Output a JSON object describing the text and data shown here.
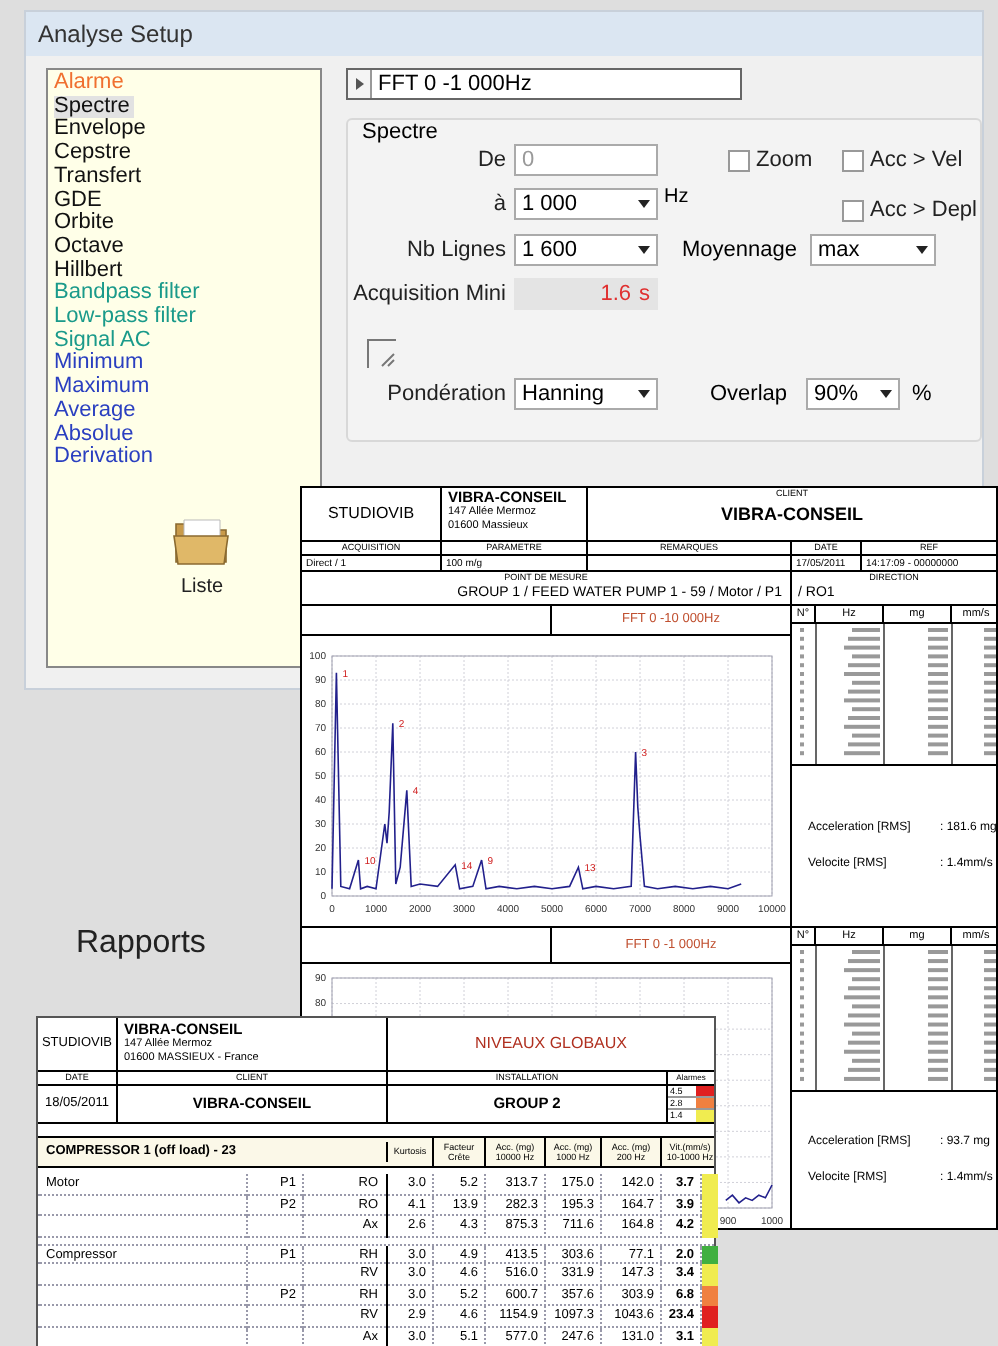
{
  "setup_window": {
    "title": "Analyse Setup",
    "analysis_list": [
      {
        "label": "Alarme",
        "kind": "alarm",
        "selected": false
      },
      {
        "label": "Spectre",
        "kind": "spectral",
        "selected": true
      },
      {
        "label": "Envelope",
        "kind": "spectral",
        "selected": false
      },
      {
        "label": "Cepstre",
        "kind": "spectral",
        "selected": false
      },
      {
        "label": "Transfert",
        "kind": "spectral",
        "selected": false
      },
      {
        "label": "GDE",
        "kind": "spectral",
        "selected": false
      },
      {
        "label": "Orbite",
        "kind": "spectral",
        "selected": false
      },
      {
        "label": "Octave",
        "kind": "spectral",
        "selected": false
      },
      {
        "label": "Hillbert",
        "kind": "spectral",
        "selected": false
      },
      {
        "label": "Bandpass filter",
        "kind": "filter",
        "selected": false
      },
      {
        "label": "Low-pass filter",
        "kind": "filter",
        "selected": false
      },
      {
        "label": "Signal AC",
        "kind": "filter",
        "selected": false
      },
      {
        "label": "Minimum",
        "kind": "math",
        "selected": false
      },
      {
        "label": "Maximum",
        "kind": "math",
        "selected": false
      },
      {
        "label": "Average",
        "kind": "math",
        "selected": false
      },
      {
        "label": "Absolue",
        "kind": "math",
        "selected": false
      },
      {
        "label": "Derivation",
        "kind": "math",
        "selected": false
      }
    ],
    "analysis_header": {
      "label": "FFT 0 -1 000Hz"
    },
    "spectre_group": {
      "title": "Spectre",
      "de": {
        "label": "De",
        "value": "0",
        "disabled": true
      },
      "a": {
        "label": "à",
        "value": "1 000",
        "unit": "Hz"
      },
      "nb_lignes": {
        "label": "Nb Lignes",
        "value": "1 600"
      },
      "acquisition_mini": {
        "label": "Acquisition Mini",
        "value": "1.6",
        "unit": "s"
      },
      "zoom": {
        "label": "Zoom",
        "checked": false
      },
      "acc_vel": {
        "label": "Acc > Vel",
        "checked": false
      },
      "acc_depl": {
        "label": "Acc > Depl",
        "checked": false
      },
      "moyennage": {
        "label": "Moyennage",
        "value": "max"
      },
      "ponderation": {
        "label": "Pondération",
        "value": "Hanning"
      },
      "overlap": {
        "label": "Overlap",
        "value": "90%",
        "unit": "%"
      }
    }
  },
  "liste": {
    "label": "Liste"
  },
  "rapports_label": "Rapports",
  "spectrum_report": {
    "company": "STUDIOVIB",
    "address": {
      "name": "VIBRA-CONSEIL",
      "lines": [
        "147 Allée Mermoz",
        "01600 Massieux"
      ]
    },
    "client": {
      "label": "CLIENT",
      "value": "VIBRA-CONSEIL"
    },
    "info_cells": [
      {
        "label": "ACQUISITION",
        "value": "Direct / 1"
      },
      {
        "label": "PARAMETRE",
        "value": "100 m/g"
      },
      {
        "label": "REMARQUES"
      },
      {
        "label": "DATE",
        "value": "17/05/2011"
      },
      {
        "label": "REF",
        "value": "14:17:09 - 00000000"
      }
    ],
    "measure_point": {
      "label": "POINT DE MESURE",
      "value": "GROUP 1 / FEED WATER PUMP 1 - 59 / Motor / P1"
    },
    "direction": {
      "label": "DIRECTION",
      "value": "/ RO1"
    },
    "sections": [
      {
        "title": "FFT 0 -10 000Hz",
        "table_columns": [
          "N°",
          "Hz",
          "mg",
          "mm/s"
        ],
        "rms": [
          {
            "label": "Acceleration [RMS]",
            "value": ": 181.6 mg"
          },
          {
            "label": "Velocite [RMS]",
            "value": ": 1.4mm/s"
          }
        ],
        "chart_data": {
          "type": "line",
          "x": [
            0,
            100,
            200,
            400,
            600,
            650,
            800,
            1000,
            1200,
            1250,
            1300,
            1380,
            1450,
            1550,
            1700,
            1800,
            2000,
            2400,
            2800,
            2900,
            3200,
            3400,
            3500,
            3800,
            4200,
            4600,
            5000,
            5400,
            5600,
            5700,
            6000,
            6400,
            6800,
            6900,
            6950,
            7000,
            7100,
            7400,
            7800,
            8200,
            8600,
            9000,
            9300
          ],
          "series": [
            {
              "color": "#22208c",
              "values": [
                3,
                93,
                4,
                3,
                15,
                3,
                4,
                3,
                30,
                22,
                35,
                72,
                5,
                12,
                44,
                4,
                5,
                4,
                13,
                3,
                4,
                15,
                3,
                4,
                3,
                4,
                3,
                4,
                12,
                3,
                4,
                3,
                4,
                60,
                37,
                25,
                4,
                3,
                4,
                3,
                4,
                3,
                5
              ]
            }
          ],
          "xlim": [
            0,
            10000
          ],
          "ylim": [
            0,
            100
          ],
          "xticks": [
            0,
            1000,
            2000,
            3000,
            4000,
            5000,
            6000,
            7000,
            8000,
            9000,
            10000
          ],
          "yticks": [
            0,
            10,
            20,
            30,
            40,
            50,
            60,
            70,
            80,
            90,
            100
          ],
          "grid": true
        },
        "peak_labels": [
          "1",
          "2",
          "3",
          "4",
          "10",
          "14",
          "9",
          "13"
        ]
      },
      {
        "title": "FFT 0 -1 000Hz",
        "table_columns": [
          "N°",
          "Hz",
          "mg",
          "mm/s"
        ],
        "rms": [
          {
            "label": "Acceleration [RMS]",
            "value": ": 93.7 mg"
          },
          {
            "label": "Velocite [RMS]",
            "value": ": 1.4mm/s"
          }
        ],
        "chart_data": {
          "type": "line",
          "x": [
            895,
            910,
            925,
            940,
            955,
            970,
            985,
            1000
          ],
          "series": [
            {
              "color": "#22208c",
              "values": [
                3,
                5,
                2,
                4,
                3,
                5,
                4,
                9
              ]
            }
          ],
          "xlim": [
            0,
            1000
          ],
          "ylim": [
            0,
            90
          ],
          "xticks": [
            900,
            1000
          ],
          "yticks": [
            80,
            90
          ],
          "grid": true
        }
      }
    ]
  },
  "levels_report": {
    "company": "STUDIOVIB",
    "address": {
      "name": "VIBRA-CONSEIL",
      "lines": [
        "147 Allée Mermoz",
        "01600 MASSIEUX - France"
      ]
    },
    "title": "NIVEAUX GLOBAUX",
    "date": {
      "label": "DATE",
      "value": "18/05/2011"
    },
    "client": {
      "label": "CLIENT",
      "value": "VIBRA-CONSEIL"
    },
    "installation": {
      "label": "INSTALLATION",
      "value": "GROUP 2"
    },
    "alarms": {
      "label": "Alarmes",
      "levels": [
        {
          "value": "4.5",
          "color": "#e02020"
        },
        {
          "value": "2.8",
          "color": "#f08040"
        },
        {
          "value": "1.4",
          "color": "#f0ec50"
        }
      ]
    },
    "machine": "COMPRESSOR 1 (off load) - 23",
    "columns": [
      "Kurtosis",
      "Facteur Crête",
      "Acc. (mg) 10000 Hz",
      "Acc. (mg) 1000 Hz",
      "Acc. (mg) 200 Hz",
      "Vit.(mm/s) 10-1000 Hz"
    ],
    "rows": [
      {
        "group": "Motor",
        "point": "P1",
        "direction": "RO",
        "values": [
          "3.0",
          "5.2",
          "313.7",
          "175.0",
          "142.0",
          "3.7"
        ],
        "color": "#f0ec50"
      },
      {
        "point": "P2",
        "direction": "RO",
        "values": [
          "4.1",
          "13.9",
          "282.3",
          "195.3",
          "164.7",
          "3.9"
        ],
        "color": "#f0ec50"
      },
      {
        "direction": "Ax",
        "values": [
          "2.6",
          "4.3",
          "875.3",
          "711.6",
          "164.8",
          "4.2"
        ],
        "color": "#f0ec50"
      },
      {
        "group": "Compressor",
        "point": "P1",
        "direction": "RH",
        "values": [
          "3.0",
          "4.9",
          "413.5",
          "303.6",
          "77.1",
          "2.0"
        ],
        "color": "#40b040"
      },
      {
        "direction": "RV",
        "values": [
          "3.0",
          "4.6",
          "516.0",
          "331.9",
          "147.3",
          "3.4"
        ],
        "color": "#f0ec50"
      },
      {
        "point": "P2",
        "direction": "RH",
        "values": [
          "3.0",
          "5.2",
          "600.7",
          "357.6",
          "303.9",
          "6.8"
        ],
        "color": "#f08040"
      },
      {
        "direction": "RV",
        "values": [
          "2.9",
          "4.6",
          "1154.9",
          "1097.3",
          "1043.6",
          "23.4"
        ],
        "color": "#e02020"
      },
      {
        "direction": "Ax",
        "values": [
          "3.0",
          "5.1",
          "577.0",
          "247.6",
          "131.0",
          "3.1"
        ],
        "color": "#f0ec50"
      }
    ]
  }
}
